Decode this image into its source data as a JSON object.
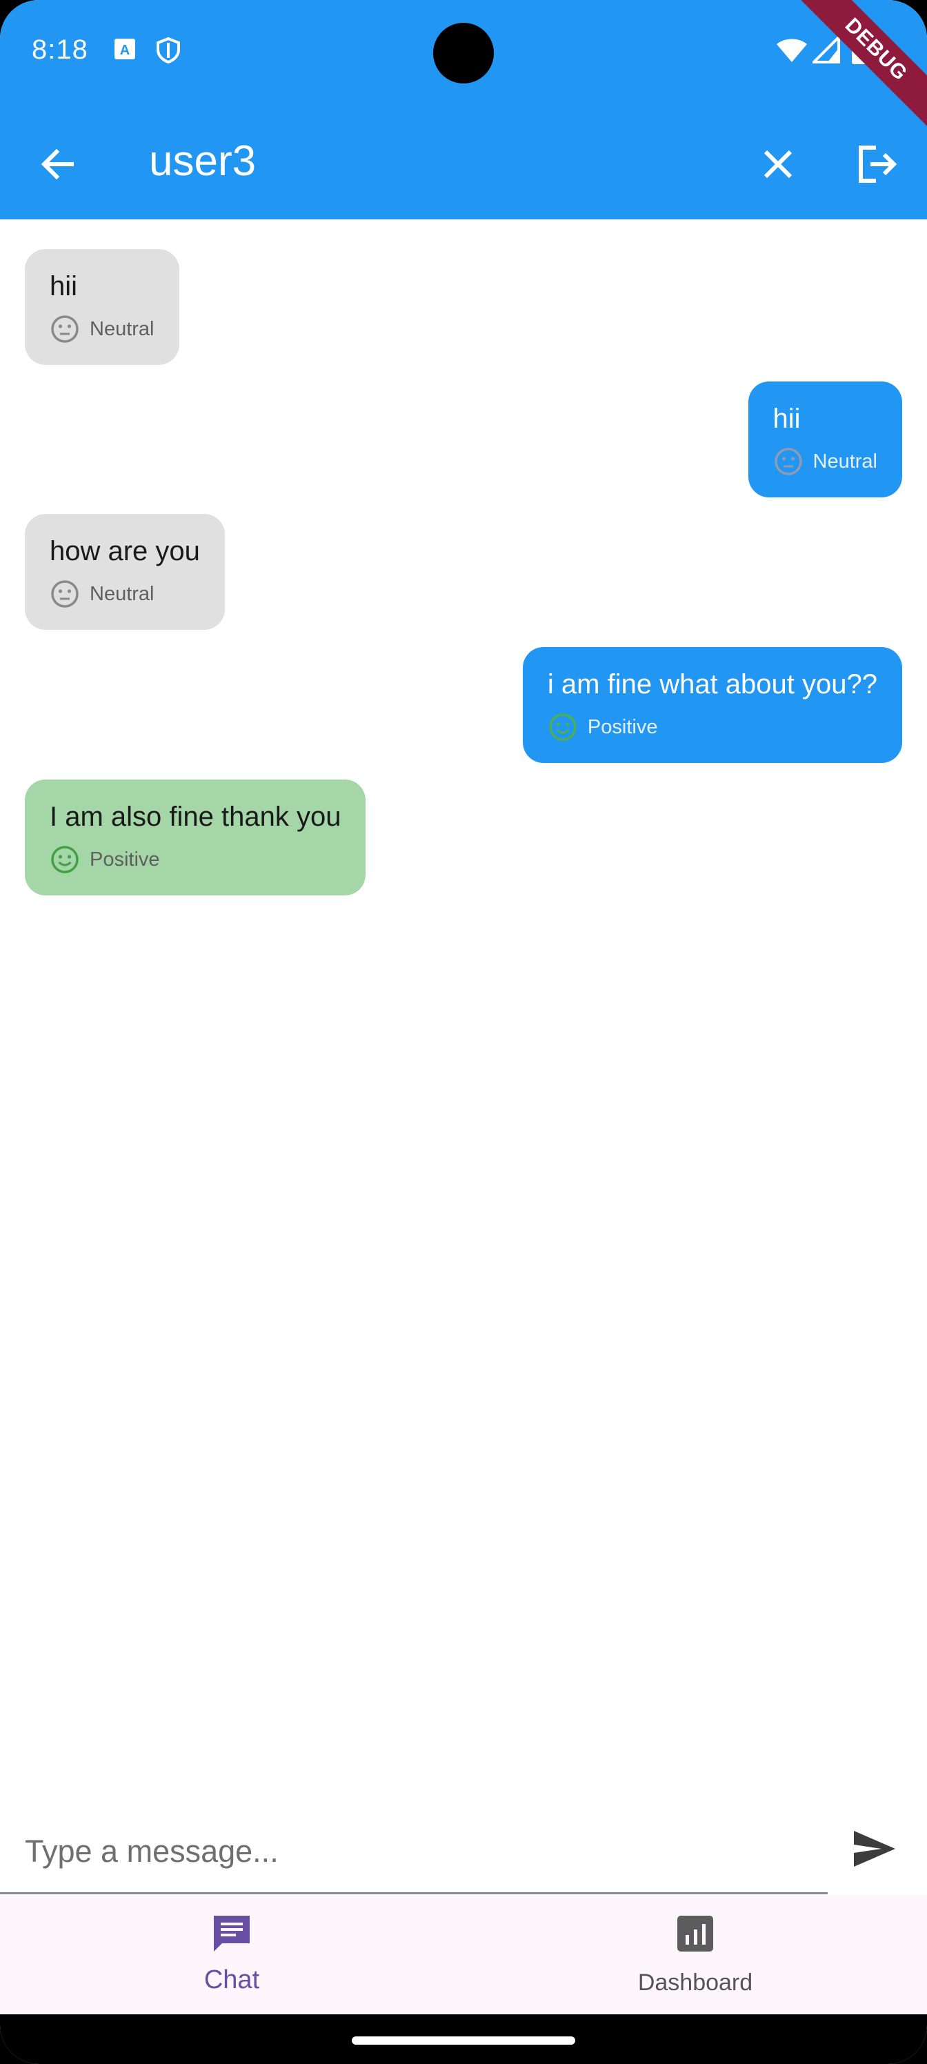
{
  "status_bar": {
    "time": "8:18"
  },
  "app_bar": {
    "title": "user3",
    "color": "#2196f3"
  },
  "debug_banner": "DEBUG",
  "messages": [
    {
      "text": "hii",
      "sentiment": "Neutral",
      "from": "other"
    },
    {
      "text": "hii",
      "sentiment": "Neutral",
      "from": "me"
    },
    {
      "text": "how are you",
      "sentiment": "Neutral",
      "from": "other"
    },
    {
      "text": "i am fine what about you??",
      "sentiment": "Positive",
      "from": "me"
    },
    {
      "text": "I am also fine thank you",
      "sentiment": "Positive",
      "from": "other"
    }
  ],
  "input": {
    "placeholder": "Type a message..."
  },
  "bottom_nav": {
    "items": [
      {
        "label": "Chat",
        "icon": "chat-icon",
        "active": true
      },
      {
        "label": "Dashboard",
        "icon": "dashboard-icon",
        "active": false
      }
    ]
  },
  "colors": {
    "primary": "#2196f3",
    "received_bubble": "#e0e0e0",
    "positive_bubble": "#a5d6a7",
    "nav_active": "#6750a4",
    "positive_icon": "#4caf50"
  }
}
